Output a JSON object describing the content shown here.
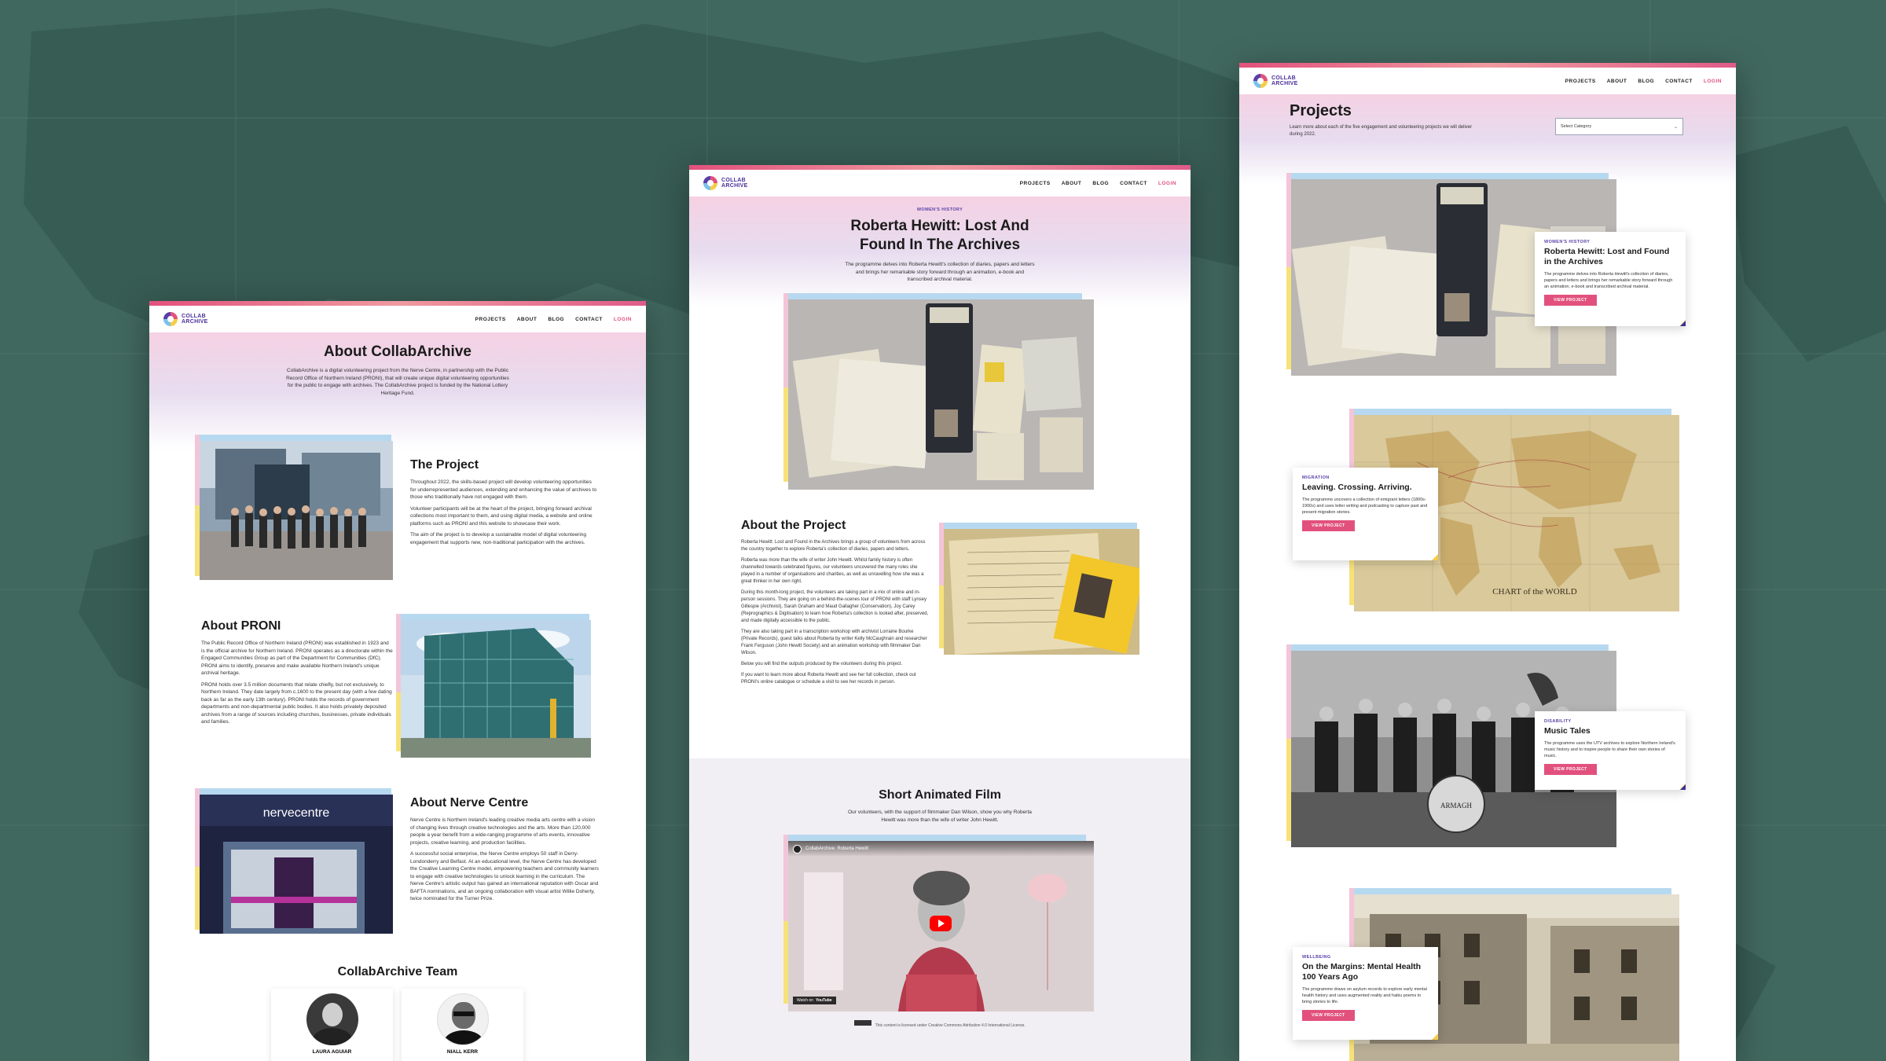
{
  "nav": {
    "logo_line1": "COLLAB",
    "logo_line2": "ARCHIVE",
    "items": [
      "PROJECTS",
      "ABOUT",
      "BLOG",
      "CONTACT",
      "LOGIN"
    ]
  },
  "about_page": {
    "title": "About CollabArchive",
    "intro": "CollabArchive is a digital volunteering project from the Nerve Centre, in partnership with the Public Record Office of Northern Ireland (PRONI), that will create unique digital volunteering opportunities for the public to engage with archives. The CollabArchive project is funded by the National Lottery Heritage Fund.",
    "project_title": "The Project",
    "project_p1": "Throughout 2022, the skills-based project will develop volunteering opportunities for underrepresented audiences, extending and enhancing the value of archives to those who traditionally have not engaged with them.",
    "project_p2": "Volunteer participants will be at the heart of the project, bringing forward archival collections most important to them, and using digital media, a website and online platforms such as PRONI and this website to showcase their work.",
    "project_p3": "The aim of the project is to develop a sustainable model of digital volunteering engagement that supports new, non-traditional participation with the archives.",
    "proni_title": "About PRONI",
    "proni_p1": "The Public Record Office of Northern Ireland (PRONI) was established in 1923 and is the official archive for Northern Ireland. PRONI operates as a directorate within the Engaged Communities Group as part of the Department for Communities (DfC). PRONI aims to identify, preserve and make available Northern Ireland's unique archival heritage.",
    "proni_p2": "PRONI holds over 3.5 million documents that relate chiefly, but not exclusively, to Northern Ireland. They date largely from c.1600 to the present day (with a few dating back as far as the early 13th century). PRONI holds the records of government departments and non-departmental public bodies. It also holds privately deposited archives from a range of sources including churches, businesses, private individuals and families.",
    "nerve_title": "About Nerve Centre",
    "nerve_p1": "Nerve Centre is Northern Ireland's leading creative media arts centre with a vision of changing lives through creative technologies and the arts. More than 120,000 people a year benefit from a wide-ranging programme of arts events, innovative projects, creative learning, and production facilities.",
    "nerve_p2": "A successful social enterprise, the Nerve Centre employs 50 staff in Derry-Londonderry and Belfast. At an educational level, the Nerve Centre has developed the Creative Learning Centre model, empowering teachers and community learners to engage with creative technologies to unlock learning in the curriculum. The Nerve Centre's artistic output has gained an international reputation with Oscar and BAFTA nominations, and an ongoing collaboration with visual artist Willie Doherty, twice nominated for the Turner Prize.",
    "nerve_sign": "nervecentre",
    "team_title": "CollabArchive Team",
    "team": [
      {
        "name": "LAURA AGUIAR"
      },
      {
        "name": "NIALL KERR"
      }
    ]
  },
  "hewitt_page": {
    "tag": "WOMEN'S HISTORY",
    "title_line1": "Roberta Hewitt: Lost And",
    "title_line2": "Found In The Archives",
    "intro": "The programme delves into Roberta Hewitt's collection of diaries, papers and letters and brings her remarkable story forward through an animation, e-book and transcribed archival material.",
    "about_title": "About the Project",
    "about_p1": "Roberta Hewitt: Lost and Found in the Archives brings a group of volunteers from across the country together to explore Roberta's collection of diaries, papers and letters.",
    "about_p2": "Roberta was more than the wife of writer John Hewitt. Whilst family history is often channelled towards celebrated figures, our volunteers uncovered the many roles she played in a number of organisations and charities, as well as unravelling how she was a great thinker in her own right.",
    "about_p3": "During this month-long project, the volunteers are taking part in a mix of online and in-person sessions. They are going on a behind-the-scenes tour of PRONI with staff Lynsey Gillespie (Archivist), Sarah Graham and Maud Gallagher (Conservation), Joy Carey (Reprographics & Digitisation) to learn how Roberta's collection is looked after, preserved, and made digitally accessible to the public.",
    "about_p4": "They are also taking part in a transcription workshop with archivist Lorraine Bourke (Private Records), guest talks about Roberta by writer Kelly McCaughrain and researcher Frank Ferguson (John Hewitt Society) and an animation workshop with filmmaker Dan Wilson.",
    "about_p5": "Below you will find the outputs produced by the volunteers during this project.",
    "about_p6": "If you want to learn more about Roberta Hewitt and see her full collection, check out PRONI's online catalogue or schedule a visit to see her records in person.",
    "film_title": "Short Animated Film",
    "film_intro": "Our volunteers, with the support of filmmaker Dan Wilson, show you why Roberta Hewitt was more than the wife of writer John Hewitt.",
    "video_title": "CollabArchive: Roberta Hewitt",
    "video_watch": "Watch on",
    "video_youtube": "YouTube",
    "license": "This content is licensed under Creative Commons Attribution 4.0 International License."
  },
  "projects_page": {
    "title": "Projects",
    "intro": "Learn more about each of the five engagement and volunteering projects we will deliver during 2022.",
    "select_placeholder": "Select Category",
    "button_label": "VIEW PROJECT",
    "map_caption": "CHART of the WORLD",
    "band_sign": "ARMAGH",
    "items": [
      {
        "tag": "WOMEN'S HISTORY",
        "title": "Roberta Hewitt: Lost and Found in the Archives",
        "text": "The programme delves into Roberta Hewitt's collection of diaries, papers and letters and brings her remarkable story forward through an animation, e-book and transcribed archival material."
      },
      {
        "tag": "MIGRATION",
        "title": "Leaving. Crossing. Arriving.",
        "text": "The programme uncovers a collection of emigrant letters (1800s-1900s) and uses letter writing and podcasting to capture past and present migration stories."
      },
      {
        "tag": "DISABILITY",
        "title": "Music Tales",
        "text": "The programme uses the UTV archives to explore Northern Ireland's music history and to inspire people to share their own stories of music."
      },
      {
        "tag": "WELLBEING",
        "title": "On the Margins: Mental Health 100 Years Ago",
        "text": "The programme draws on asylum records to explore early mental health history and uses augmented reality and haiku poems to bring stories to life."
      }
    ]
  }
}
